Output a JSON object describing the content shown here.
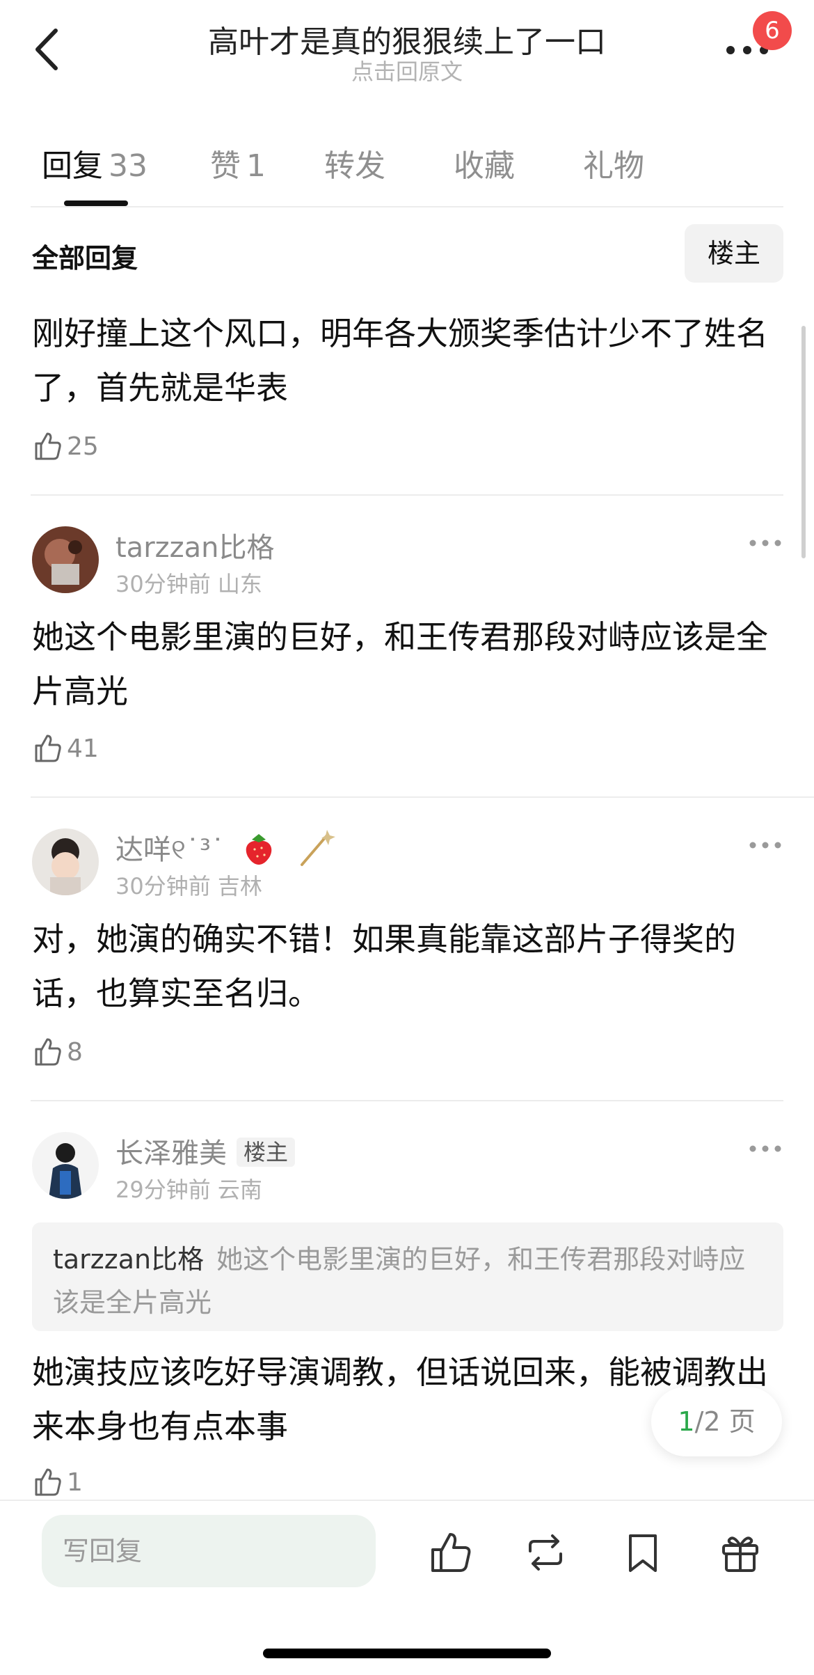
{
  "header": {
    "title": "高叶才是真的狠狠续上了一口",
    "subtitle": "点击回原文",
    "notification_count": "6"
  },
  "tabs": [
    {
      "label": "回复",
      "count": "33",
      "active": true
    },
    {
      "label": "赞",
      "count": "1"
    },
    {
      "label": "转发",
      "count": ""
    },
    {
      "label": "收藏",
      "count": ""
    },
    {
      "label": "礼物",
      "count": ""
    }
  ],
  "filter": {
    "all_replies": "全部回复",
    "op_only": "楼主"
  },
  "top_comment": {
    "text": "刚好撞上这个风口，明年各大颁奖季估计少不了姓名了，首先就是华表",
    "likes": "25"
  },
  "comments": [
    {
      "user": "tarzzan比格",
      "time": "30分钟前",
      "location": "山东",
      "text": "她这个电影里演的巨好，和王传君那段对峙应该是全片高光",
      "likes": "41"
    },
    {
      "user": "达咩୧˙³˙",
      "badges": [
        "strawberry-icon",
        "wand-icon"
      ],
      "time": "30分钟前",
      "location": "吉林",
      "text": "对，她演的确实不错！如果真能靠这部片子得奖的话，也算实至名归。",
      "likes": "8"
    },
    {
      "user": "长泽雅美",
      "tag": "楼主",
      "time": "29分钟前",
      "location": "云南",
      "quote_user": "tarzzan比格",
      "quote_text": "她这个电影里演的巨好，和王传君那段对峙应该是全片高光",
      "text": "她演技应该吃好导演调教，但话说回来，能被调教出来本身也有点本事",
      "likes": "1"
    }
  ],
  "pager": {
    "current": "1",
    "total": "/2 页"
  },
  "bottom_bar": {
    "write_placeholder": "写回复"
  },
  "colors": {
    "accent_green": "#2aa84a",
    "badge_red": "#f24b4b",
    "input_bg": "#edf3ef"
  }
}
